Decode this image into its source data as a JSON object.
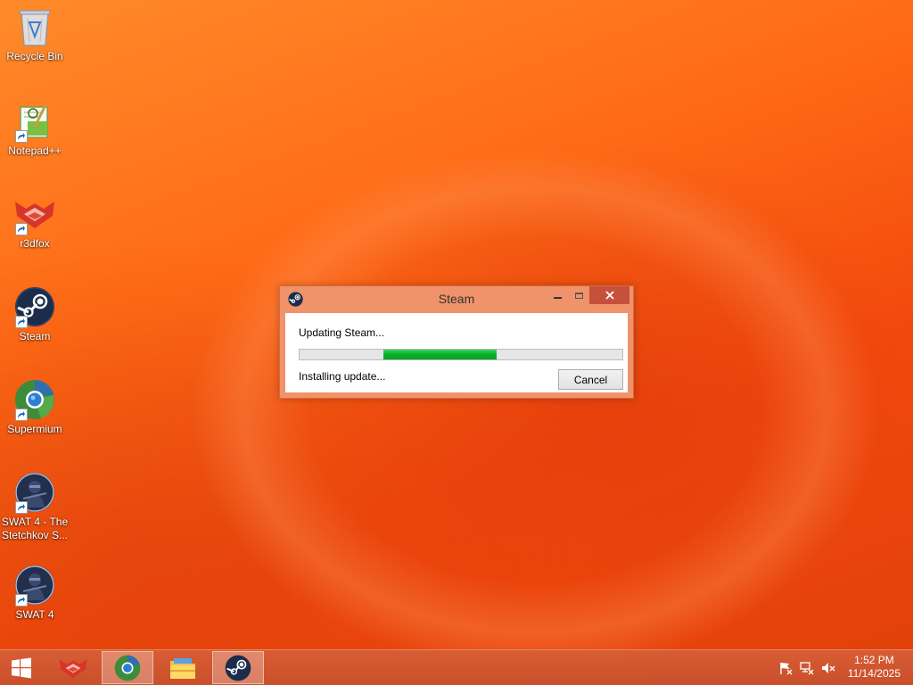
{
  "desktop": {
    "icons": [
      {
        "label": "Recycle Bin"
      },
      {
        "label": "Notepad++"
      },
      {
        "label": "r3dfox"
      },
      {
        "label": "Steam"
      },
      {
        "label": "Supermium"
      },
      {
        "label": "SWAT 4 - The\nStetchkov S..."
      },
      {
        "label": "SWAT 4"
      }
    ]
  },
  "dialog": {
    "title": "Steam",
    "status_primary": "Updating Steam...",
    "status_secondary": "Installing update...",
    "cancel_label": "Cancel",
    "progress_fill_start": 0.26,
    "progress_fill_width": 0.35,
    "progress_color": "#06b025",
    "close_button_color": "#c7503d"
  },
  "taskbar": {
    "items": [
      "r3dfox",
      "Supermium",
      "File Explorer",
      "Steam"
    ],
    "active_items": [
      "Supermium",
      "Steam"
    ],
    "tray_icons": [
      "flag-icon",
      "network-icon",
      "speaker-muted-icon"
    ],
    "clock": {
      "time": "1:52 PM",
      "date": "11/14/2025"
    }
  },
  "colors": {
    "wallpaper_primary": "#ff6a16",
    "taskbar": "#d05a35"
  }
}
